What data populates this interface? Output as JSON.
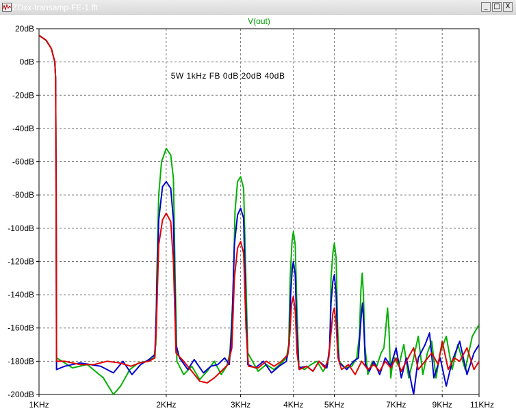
{
  "window": {
    "title": "ZDxx-transamp-FE-1.fft",
    "minimize_glyph": "_",
    "maximize_glyph": "□",
    "close_glyph": "X"
  },
  "chart_data": {
    "type": "line",
    "title": "V(out)",
    "annotation": "5W 1kHz FB 0dB 20dB 40dB",
    "x_scale": "log",
    "xlim": [
      1000,
      11000
    ],
    "ylim": [
      -200,
      20
    ],
    "x_ticks": [
      {
        "value": 1000,
        "label": "1KHz"
      },
      {
        "value": 2000,
        "label": "2KHz"
      },
      {
        "value": 3000,
        "label": "3KHz"
      },
      {
        "value": 4000,
        "label": "4KHz"
      },
      {
        "value": 5000,
        "label": "5KHz"
      },
      {
        "value": 7000,
        "label": "7KHz"
      },
      {
        "value": 9000,
        "label": "9KHz"
      },
      {
        "value": 11000,
        "label": "11KHz"
      }
    ],
    "y_ticks": [
      {
        "value": 20,
        "label": "20dB"
      },
      {
        "value": 0,
        "label": "0dB"
      },
      {
        "value": -20,
        "label": "-20dB"
      },
      {
        "value": -40,
        "label": "-40dB"
      },
      {
        "value": -60,
        "label": "-60dB"
      },
      {
        "value": -80,
        "label": "-80dB"
      },
      {
        "value": -100,
        "label": "-100dB"
      },
      {
        "value": -120,
        "label": "-120dB"
      },
      {
        "value": -140,
        "label": "-140dB"
      },
      {
        "value": -160,
        "label": "-160dB"
      },
      {
        "value": -180,
        "label": "-180dB"
      },
      {
        "value": -200,
        "label": "-200dB"
      }
    ],
    "grid": true,
    "series": [
      {
        "color": "#00b000",
        "points": [
          [
            1000,
            16
          ],
          [
            1040,
            13
          ],
          [
            1070,
            8
          ],
          [
            1090,
            0
          ],
          [
            1095,
            -10
          ],
          [
            1098,
            -80
          ],
          [
            1100,
            -178
          ],
          [
            1150,
            -181
          ],
          [
            1200,
            -184
          ],
          [
            1300,
            -182
          ],
          [
            1420,
            -190
          ],
          [
            1500,
            -200
          ],
          [
            1560,
            -195
          ],
          [
            1640,
            -185
          ],
          [
            1720,
            -181
          ],
          [
            1800,
            -180
          ],
          [
            1870,
            -178
          ],
          [
            1890,
            -170
          ],
          [
            1900,
            -130
          ],
          [
            1920,
            -80
          ],
          [
            1950,
            -60
          ],
          [
            2000,
            -52
          ],
          [
            2050,
            -56
          ],
          [
            2080,
            -70
          ],
          [
            2100,
            -130
          ],
          [
            2120,
            -180
          ],
          [
            2200,
            -188
          ],
          [
            2300,
            -183
          ],
          [
            2400,
            -191
          ],
          [
            2500,
            -186
          ],
          [
            2600,
            -180
          ],
          [
            2700,
            -188
          ],
          [
            2780,
            -183
          ],
          [
            2830,
            -175
          ],
          [
            2880,
            -140
          ],
          [
            2910,
            -90
          ],
          [
            2950,
            -72
          ],
          [
            3000,
            -69
          ],
          [
            3050,
            -76
          ],
          [
            3080,
            -120
          ],
          [
            3120,
            -175
          ],
          [
            3200,
            -180
          ],
          [
            3300,
            -186
          ],
          [
            3450,
            -182
          ],
          [
            3600,
            -185
          ],
          [
            3750,
            -181
          ],
          [
            3850,
            -178
          ],
          [
            3900,
            -170
          ],
          [
            3930,
            -130
          ],
          [
            3970,
            -108
          ],
          [
            4000,
            -102
          ],
          [
            4040,
            -110
          ],
          [
            4080,
            -150
          ],
          [
            4120,
            -183
          ],
          [
            4250,
            -185
          ],
          [
            4400,
            -182
          ],
          [
            4550,
            -180
          ],
          [
            4700,
            -186
          ],
          [
            4820,
            -182
          ],
          [
            4880,
            -170
          ],
          [
            4910,
            -130
          ],
          [
            4960,
            -115
          ],
          [
            5000,
            -109
          ],
          [
            5050,
            -118
          ],
          [
            5090,
            -160
          ],
          [
            5130,
            -180
          ],
          [
            5300,
            -184
          ],
          [
            5500,
            -183
          ],
          [
            5650,
            -178
          ],
          [
            5730,
            -165
          ],
          [
            5780,
            -137
          ],
          [
            5820,
            -127
          ],
          [
            5860,
            -140
          ],
          [
            5900,
            -170
          ],
          [
            6000,
            -188
          ],
          [
            6150,
            -180
          ],
          [
            6300,
            -183
          ],
          [
            6450,
            -175
          ],
          [
            6550,
            -172
          ],
          [
            6620,
            -160
          ],
          [
            6680,
            -148
          ],
          [
            6730,
            -160
          ],
          [
            6800,
            -190
          ],
          [
            6900,
            -177
          ],
          [
            7100,
            -183
          ],
          [
            7300,
            -170
          ],
          [
            7500,
            -190
          ],
          [
            7700,
            -178
          ],
          [
            7900,
            -165
          ],
          [
            8100,
            -188
          ],
          [
            8300,
            -175
          ],
          [
            8500,
            -168
          ],
          [
            8700,
            -190
          ],
          [
            8900,
            -175
          ],
          [
            9200,
            -165
          ],
          [
            9500,
            -185
          ],
          [
            9800,
            -170
          ],
          [
            10200,
            -185
          ],
          [
            10600,
            -165
          ],
          [
            11000,
            -158
          ]
        ]
      },
      {
        "color": "#0000d0",
        "points": [
          [
            1000,
            16
          ],
          [
            1040,
            13
          ],
          [
            1070,
            8
          ],
          [
            1090,
            0
          ],
          [
            1095,
            -10
          ],
          [
            1098,
            -90
          ],
          [
            1100,
            -185
          ],
          [
            1150,
            -183
          ],
          [
            1250,
            -181
          ],
          [
            1400,
            -183
          ],
          [
            1500,
            -187
          ],
          [
            1580,
            -180
          ],
          [
            1660,
            -188
          ],
          [
            1740,
            -182
          ],
          [
            1820,
            -179
          ],
          [
            1880,
            -176
          ],
          [
            1895,
            -150
          ],
          [
            1920,
            -95
          ],
          [
            1960,
            -75
          ],
          [
            2000,
            -72
          ],
          [
            2050,
            -76
          ],
          [
            2080,
            -95
          ],
          [
            2110,
            -170
          ],
          [
            2150,
            -178
          ],
          [
            2250,
            -185
          ],
          [
            2330,
            -179
          ],
          [
            2450,
            -187
          ],
          [
            2550,
            -183
          ],
          [
            2650,
            -182
          ],
          [
            2750,
            -178
          ],
          [
            2820,
            -182
          ],
          [
            2860,
            -160
          ],
          [
            2900,
            -110
          ],
          [
            2950,
            -92
          ],
          [
            3000,
            -88
          ],
          [
            3050,
            -94
          ],
          [
            3080,
            -140
          ],
          [
            3120,
            -182
          ],
          [
            3250,
            -184
          ],
          [
            3400,
            -180
          ],
          [
            3550,
            -187
          ],
          [
            3700,
            -183
          ],
          [
            3850,
            -180
          ],
          [
            3910,
            -170
          ],
          [
            3940,
            -140
          ],
          [
            3975,
            -124
          ],
          [
            4000,
            -120
          ],
          [
            4040,
            -128
          ],
          [
            4080,
            -165
          ],
          [
            4120,
            -184
          ],
          [
            4300,
            -183
          ],
          [
            4450,
            -186
          ],
          [
            4600,
            -180
          ],
          [
            4800,
            -184
          ],
          [
            4870,
            -172
          ],
          [
            4910,
            -145
          ],
          [
            4960,
            -132
          ],
          [
            5000,
            -128
          ],
          [
            5050,
            -140
          ],
          [
            5090,
            -172
          ],
          [
            5140,
            -181
          ],
          [
            5350,
            -185
          ],
          [
            5550,
            -180
          ],
          [
            5700,
            -178
          ],
          [
            5760,
            -160
          ],
          [
            5800,
            -150
          ],
          [
            5830,
            -145
          ],
          [
            5870,
            -158
          ],
          [
            5920,
            -182
          ],
          [
            6050,
            -186
          ],
          [
            6200,
            -180
          ],
          [
            6400,
            -188
          ],
          [
            6600,
            -178
          ],
          [
            6800,
            -183
          ],
          [
            7000,
            -172
          ],
          [
            7200,
            -190
          ],
          [
            7400,
            -178
          ],
          [
            7700,
            -200
          ],
          [
            7900,
            -178
          ],
          [
            8200,
            -170
          ],
          [
            8400,
            -163
          ],
          [
            8600,
            -190
          ],
          [
            8900,
            -178
          ],
          [
            9200,
            -195
          ],
          [
            9500,
            -180
          ],
          [
            9900,
            -168
          ],
          [
            10300,
            -188
          ],
          [
            10700,
            -175
          ],
          [
            11000,
            -170
          ]
        ]
      },
      {
        "color": "#e00000",
        "points": [
          [
            1000,
            16
          ],
          [
            1040,
            13
          ],
          [
            1070,
            8
          ],
          [
            1090,
            0
          ],
          [
            1095,
            -10
          ],
          [
            1098,
            -95
          ],
          [
            1100,
            -180
          ],
          [
            1150,
            -180
          ],
          [
            1250,
            -182
          ],
          [
            1350,
            -182
          ],
          [
            1450,
            -180
          ],
          [
            1550,
            -181
          ],
          [
            1650,
            -183
          ],
          [
            1730,
            -181
          ],
          [
            1820,
            -180
          ],
          [
            1880,
            -178
          ],
          [
            1895,
            -160
          ],
          [
            1920,
            -110
          ],
          [
            1960,
            -95
          ],
          [
            2000,
            -91
          ],
          [
            2050,
            -96
          ],
          [
            2080,
            -120
          ],
          [
            2110,
            -175
          ],
          [
            2200,
            -180
          ],
          [
            2300,
            -186
          ],
          [
            2400,
            -192
          ],
          [
            2500,
            -193
          ],
          [
            2600,
            -190
          ],
          [
            2700,
            -186
          ],
          [
            2800,
            -182
          ],
          [
            2860,
            -172
          ],
          [
            2900,
            -130
          ],
          [
            2950,
            -112
          ],
          [
            3000,
            -108
          ],
          [
            3050,
            -115
          ],
          [
            3090,
            -160
          ],
          [
            3130,
            -183
          ],
          [
            3300,
            -184
          ],
          [
            3450,
            -180
          ],
          [
            3600,
            -183
          ],
          [
            3750,
            -180
          ],
          [
            3880,
            -176
          ],
          [
            3920,
            -165
          ],
          [
            3960,
            -146
          ],
          [
            4000,
            -141
          ],
          [
            4040,
            -150
          ],
          [
            4080,
            -175
          ],
          [
            4130,
            -185
          ],
          [
            4300,
            -183
          ],
          [
            4450,
            -186
          ],
          [
            4600,
            -180
          ],
          [
            4750,
            -184
          ],
          [
            4850,
            -178
          ],
          [
            4900,
            -165
          ],
          [
            4960,
            -151
          ],
          [
            5000,
            -148
          ],
          [
            5050,
            -158
          ],
          [
            5100,
            -178
          ],
          [
            5200,
            -185
          ],
          [
            5400,
            -182
          ],
          [
            5600,
            -188
          ],
          [
            5800,
            -180
          ],
          [
            6000,
            -185
          ],
          [
            6200,
            -182
          ],
          [
            6400,
            -186
          ],
          [
            6600,
            -180
          ],
          [
            6800,
            -184
          ],
          [
            7000,
            -178
          ],
          [
            7200,
            -186
          ],
          [
            7400,
            -180
          ],
          [
            7700,
            -172
          ],
          [
            7900,
            -185
          ],
          [
            8200,
            -180
          ],
          [
            8500,
            -175
          ],
          [
            8800,
            -182
          ],
          [
            9000,
            -168
          ],
          [
            9300,
            -185
          ],
          [
            9600,
            -178
          ],
          [
            9900,
            -180
          ],
          [
            10300,
            -172
          ],
          [
            10700,
            -185
          ],
          [
            11000,
            -180
          ]
        ]
      }
    ]
  }
}
